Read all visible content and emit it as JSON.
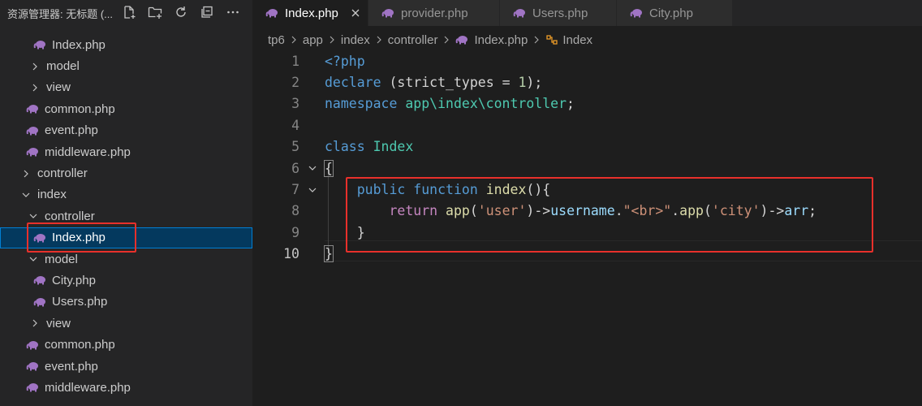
{
  "sidebar": {
    "title": "资源管理器: 无标题 (...",
    "actions": [
      "new-file-icon",
      "new-folder-icon",
      "refresh-icon",
      "collapse-all-icon",
      "more-icon"
    ],
    "tree": [
      {
        "label": "Index.php",
        "type": "php"
      },
      {
        "label": "model",
        "type": "folder-closed"
      },
      {
        "label": "view",
        "type": "folder-closed"
      },
      {
        "label": "common.php",
        "type": "php"
      },
      {
        "label": "event.php",
        "type": "php"
      },
      {
        "label": "middleware.php",
        "type": "php"
      },
      {
        "label": "controller",
        "type": "folder-closed"
      },
      {
        "label": "index",
        "type": "folder-open"
      },
      {
        "label": "controller",
        "type": "folder-open"
      },
      {
        "label": "Index.php",
        "type": "php",
        "selected": true
      },
      {
        "label": "model",
        "type": "folder-open"
      },
      {
        "label": "City.php",
        "type": "php"
      },
      {
        "label": "Users.php",
        "type": "php"
      },
      {
        "label": "view",
        "type": "folder-closed"
      },
      {
        "label": "common.php",
        "type": "php"
      },
      {
        "label": "event.php",
        "type": "php"
      },
      {
        "label": "middleware.php",
        "type": "php"
      }
    ]
  },
  "tabs": [
    {
      "label": "Index.php",
      "active": true
    },
    {
      "label": "provider.php",
      "active": false
    },
    {
      "label": "Users.php",
      "active": false
    },
    {
      "label": "City.php",
      "active": false
    }
  ],
  "breadcrumb": [
    "tp6",
    "app",
    "index",
    "controller",
    "Index.php",
    "Index"
  ],
  "editor": {
    "active_line": 10,
    "lines": [
      {
        "n": "1",
        "tokens": [
          [
            "<?php",
            "k-blue"
          ]
        ]
      },
      {
        "n": "2",
        "tokens": [
          [
            "declare",
            "k-blue"
          ],
          [
            " (",
            "t-default"
          ],
          [
            "strict_types",
            "t-default"
          ],
          [
            " = ",
            "t-default"
          ],
          [
            "1",
            "t-num"
          ],
          [
            ");",
            "t-default"
          ]
        ]
      },
      {
        "n": "3",
        "tokens": [
          [
            "namespace",
            "k-blue"
          ],
          [
            " ",
            "t-default"
          ],
          [
            "app\\index\\controller",
            "t-cls"
          ],
          [
            ";",
            "t-default"
          ]
        ]
      },
      {
        "n": "4",
        "tokens": []
      },
      {
        "n": "5",
        "tokens": [
          [
            "class",
            "k-blue"
          ],
          [
            " ",
            "t-default"
          ],
          [
            "Index",
            "t-cls"
          ]
        ]
      },
      {
        "n": "6",
        "tokens": [
          [
            "{",
            "t-default"
          ]
        ]
      },
      {
        "n": "7",
        "tokens": [
          [
            "    ",
            "t-default"
          ],
          [
            "public",
            "k-blue"
          ],
          [
            " ",
            "t-default"
          ],
          [
            "function",
            "k-blue"
          ],
          [
            " ",
            "t-default"
          ],
          [
            "index",
            "t-fn"
          ],
          [
            "(){",
            "t-default"
          ]
        ]
      },
      {
        "n": "8",
        "tokens": [
          [
            "        ",
            "t-default"
          ],
          [
            "return",
            "k-pink"
          ],
          [
            " ",
            "t-default"
          ],
          [
            "app",
            "t-fn"
          ],
          [
            "(",
            "t-default"
          ],
          [
            "'user'",
            "t-str"
          ],
          [
            ")->",
            "t-default"
          ],
          [
            "username",
            "t-var"
          ],
          [
            ".",
            "t-default"
          ],
          [
            "\"<br>\"",
            "t-str"
          ],
          [
            ".",
            "t-default"
          ],
          [
            "app",
            "t-fn"
          ],
          [
            "(",
            "t-default"
          ],
          [
            "'city'",
            "t-str"
          ],
          [
            ")->",
            "t-default"
          ],
          [
            "arr",
            "t-var"
          ],
          [
            ";",
            "t-default"
          ]
        ]
      },
      {
        "n": "9",
        "tokens": [
          [
            "    ",
            "t-default"
          ],
          [
            "}",
            "t-default"
          ]
        ]
      },
      {
        "n": "10",
        "tokens": [
          [
            "}",
            "t-default"
          ]
        ]
      }
    ]
  },
  "colors": {
    "annotation": "#e8302b",
    "selection": "#04395e",
    "php_icon": "#a074c4"
  }
}
